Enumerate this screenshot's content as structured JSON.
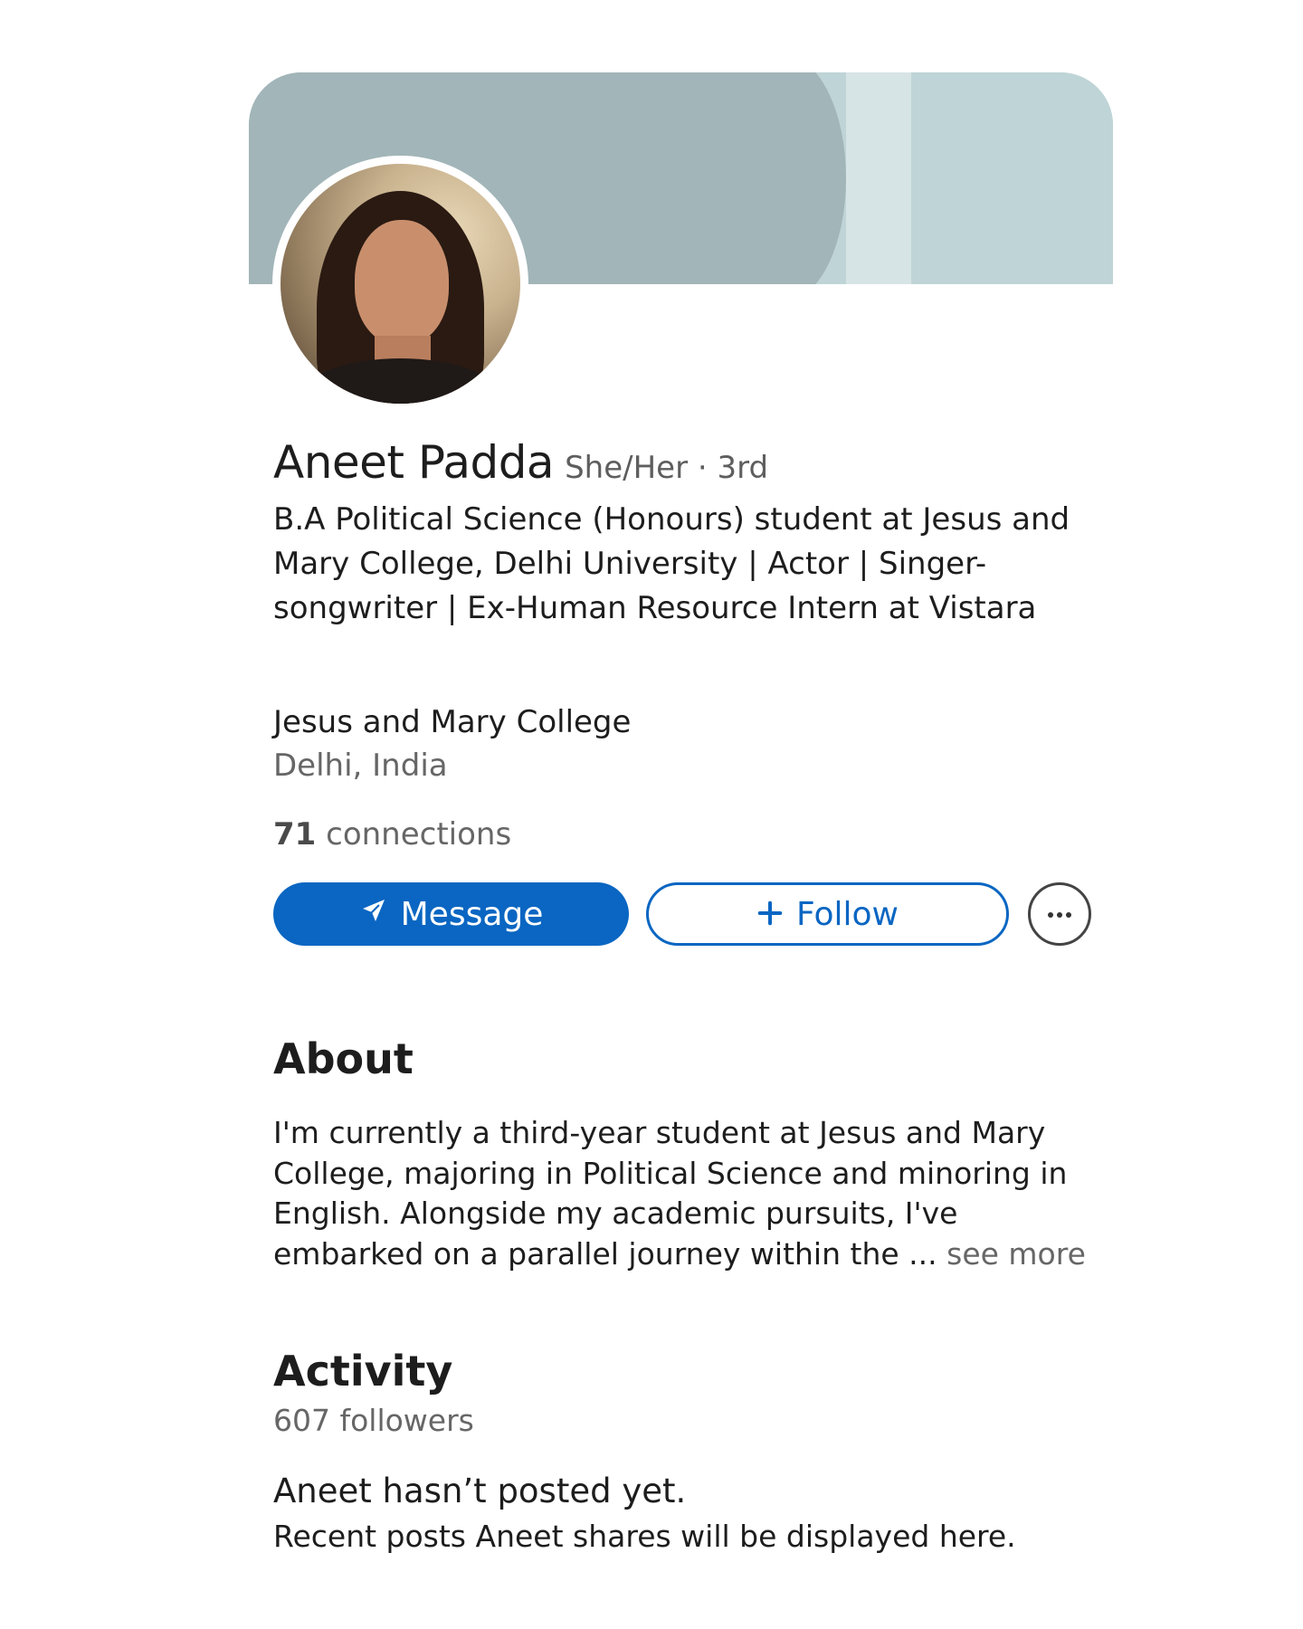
{
  "profile": {
    "name": "Aneet Padda",
    "pronoun_degree": "She/Her · 3rd",
    "headline": "B.A Political Science (Honours) student at Jesus and Mary College, Delhi University | Actor | Singer-songwriter | Ex-Human Resource Intern at Vistara",
    "school": "Jesus and Mary College",
    "location": "Delhi, India",
    "connections_count": "71",
    "connections_label": "connections"
  },
  "actions": {
    "message_label": "Message",
    "follow_label": "Follow",
    "message_icon": "send-icon",
    "follow_icon": "plus-icon",
    "more_icon": "more-icon"
  },
  "about": {
    "title": "About",
    "text": "I'm currently a third-year student at Jesus and Mary College, majoring in Political Science and minoring in English. Alongside my academic pursuits, I've embarked on a parallel journey within the ...",
    "see_more": "see more"
  },
  "activity": {
    "title": "Activity",
    "followers": "607 followers",
    "no_post": "Aneet hasn’t posted yet.",
    "no_post_sub": "Recent posts Aneet shares will be displayed here."
  },
  "colors": {
    "primary": "#0a66c2",
    "banner": "#a2b5b8",
    "banner_light": "#bfd4d6"
  }
}
